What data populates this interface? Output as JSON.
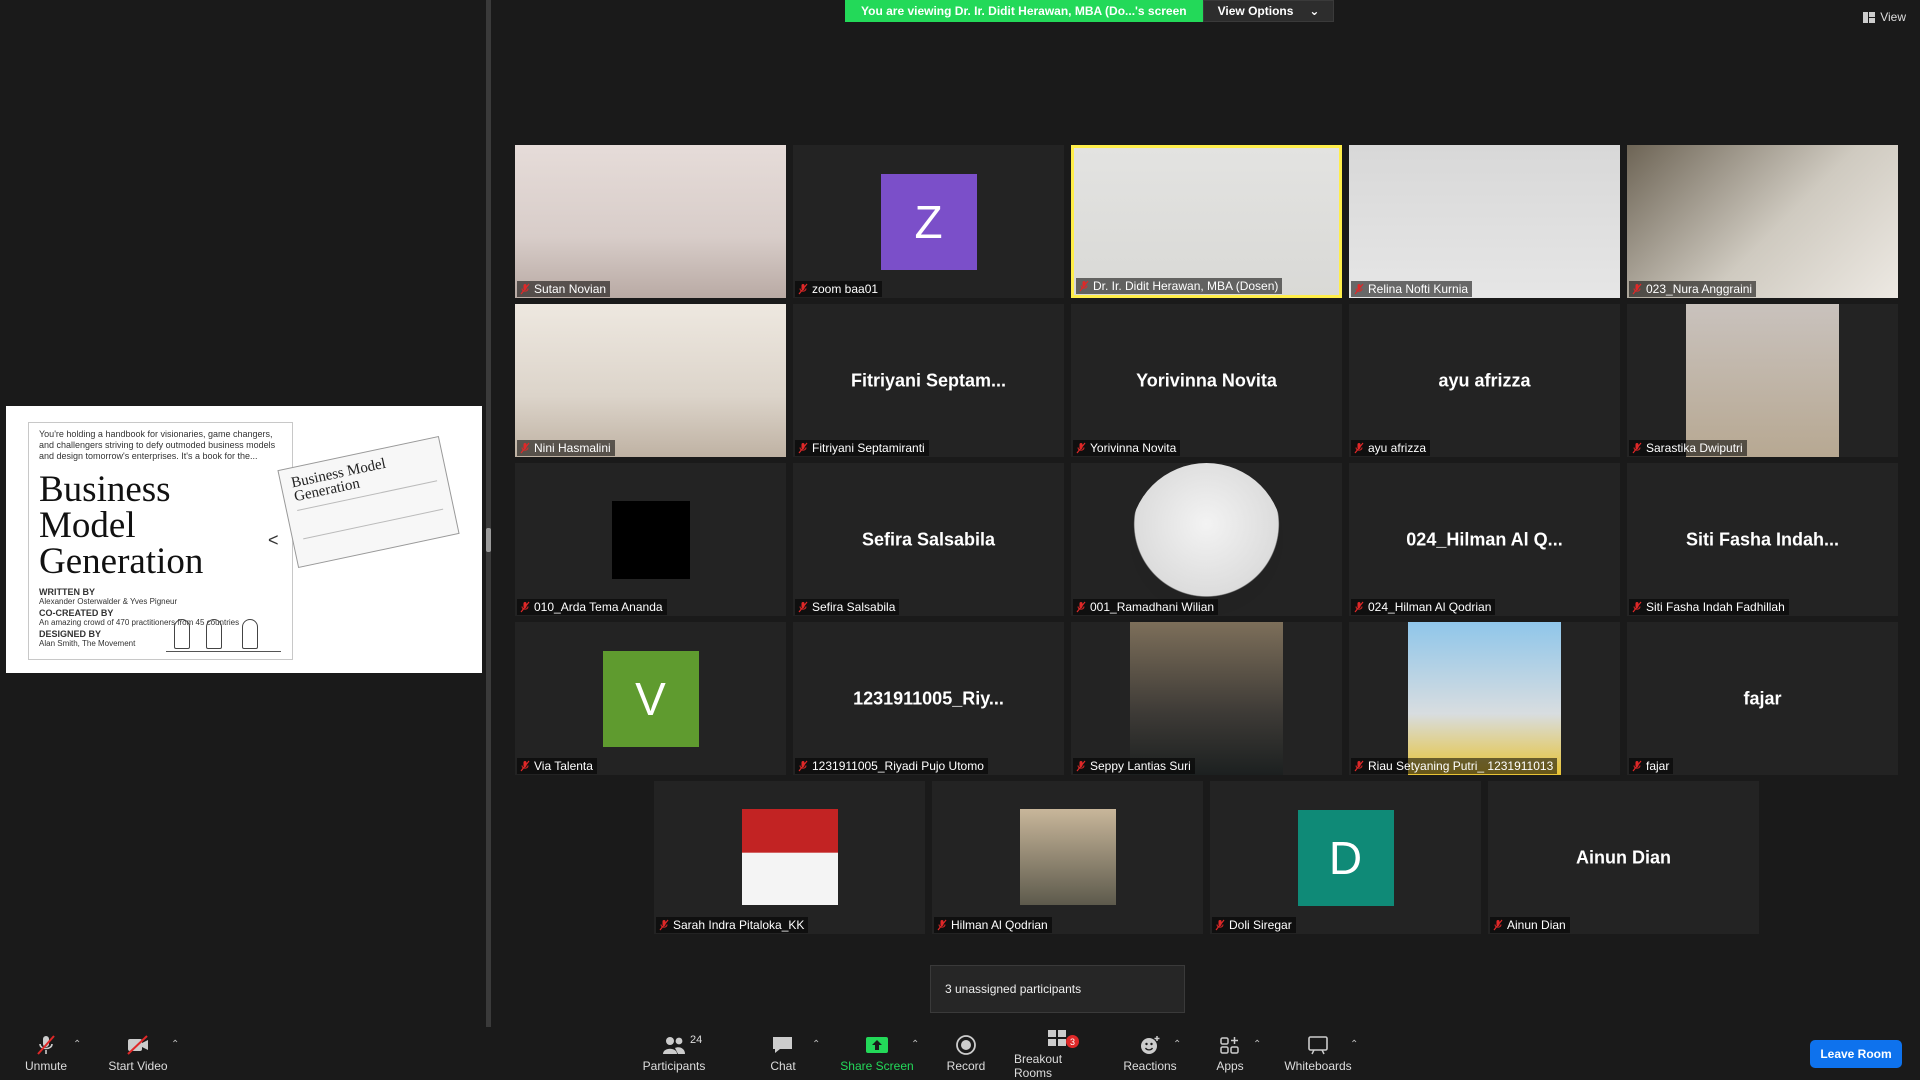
{
  "banner": {
    "viewing_text": "You are viewing Dr. Ir. Didit Herawan, MBA (Do...'s screen",
    "view_options": "View Options"
  },
  "view_label": "View",
  "shared_doc": {
    "intro": "You're holding a handbook for visionaries, game changers, and challengers striving to defy outmoded business models and design tomorrow's enterprises. It's a book for the...",
    "title_lines": [
      "Business",
      "Model",
      "Generation"
    ],
    "written_by": "WRITTEN BY",
    "authors": "Alexander Osterwalder & Yves Pigneur",
    "cocreated_by": "CO-CREATED BY",
    "cocreators": "An amazing crowd of 470 practitioners from 45 countries",
    "designed_by": "DESIGNED BY",
    "designers": "Alan Smith, The Movement",
    "book_title": "Business Model Generation"
  },
  "tiles": [
    {
      "name": "Sutan Novian",
      "label": ""
    },
    {
      "name": "zoom baa01",
      "label": "",
      "initial": "Z",
      "color": "#7b4fc9"
    },
    {
      "name": "Dr. Ir. Didit Herawan, MBA (Dosen)",
      "label": "",
      "active": true
    },
    {
      "name": "Relina Nofti Kurnia",
      "label": ""
    },
    {
      "name": "023_Nura Anggraini",
      "label": ""
    },
    {
      "name": "Nini Hasmalini",
      "label": ""
    },
    {
      "name": "Fitriyani Septamiranti",
      "label": "Fitriyani  Septam..."
    },
    {
      "name": "Yorivinna Novita",
      "label": "Yorivinna Novita"
    },
    {
      "name": "ayu afrizza",
      "label": "ayu afrizza"
    },
    {
      "name": "Sarastika Dwiputri",
      "label": ""
    },
    {
      "name": "010_Arda Tema Ananda",
      "label": ""
    },
    {
      "name": "Sefira Salsabila",
      "label": "Sefira Salsabila"
    },
    {
      "name": "001_Ramadhani Wilian",
      "label": ""
    },
    {
      "name": "024_Hilman Al Qodrian",
      "label": "024_Hilman Al Q..."
    },
    {
      "name": "Siti Fasha Indah Fadhillah",
      "label": "Siti Fasha Indah..."
    },
    {
      "name": "Via Talenta",
      "label": "",
      "initial": "V",
      "color": "#5f9b2f"
    },
    {
      "name": "1231911005_Riyadi Pujo Utomo",
      "label": "1231911005_Riy..."
    },
    {
      "name": "Seppy Lantias Suri",
      "label": ""
    },
    {
      "name": "Riau Setyaning Putri_ 1231911013",
      "label": ""
    },
    {
      "name": "fajar",
      "label": "fajar"
    },
    {
      "name": "Sarah Indra Pitaloka_KK",
      "label": ""
    },
    {
      "name": "Hilman Al Qodrian",
      "label": ""
    },
    {
      "name": "Doli Siregar",
      "label": "",
      "initial": "D",
      "color": "#0f8a77"
    },
    {
      "name": "Ainun Dian",
      "label": "Ainun Dian"
    }
  ],
  "unassigned_text": "3 unassigned participants",
  "toolbar": {
    "unmute": "Unmute",
    "start_video": "Start Video",
    "participants": "Participants",
    "participants_count": "24",
    "chat": "Chat",
    "share_screen": "Share Screen",
    "record": "Record",
    "breakout_rooms": "Breakout Rooms",
    "breakout_count": "3",
    "reactions": "Reactions",
    "apps": "Apps",
    "whiteboards": "Whiteboards",
    "leave_room": "Leave Room"
  },
  "colors": {
    "green": "#23d959",
    "active_border": "#ffee4a",
    "leave_blue": "#0e72ed",
    "mute_red": "#e02828"
  }
}
